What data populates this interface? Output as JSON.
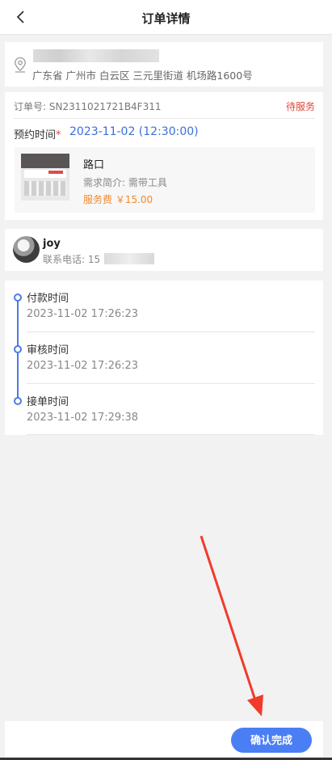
{
  "header": {
    "title": "订单详情",
    "back_icon": "chevron-left-icon"
  },
  "address": {
    "icon": "location-pin-icon",
    "text": "广东省 广州市 白云区 三元里街道 机场路1600号"
  },
  "order": {
    "number_label": "订单号:",
    "number": "SN2311021721B4F311",
    "status": "待服务",
    "appointment_label": "预约时间",
    "required_mark": "*",
    "appointment_time": "2023-11-02 (12:30:00)",
    "product": {
      "name": "路口",
      "desc": "需求简介: 需带工具",
      "price": "服务费 ￥15.00"
    }
  },
  "user": {
    "name": "joy",
    "phone_label": "联系电话: 15"
  },
  "timeline": [
    {
      "label": "付款时间",
      "time": "2023-11-02 17:26:23"
    },
    {
      "label": "审核时间",
      "time": "2023-11-02 17:26:23"
    },
    {
      "label": "接单时间",
      "time": "2023-11-02 17:29:38"
    }
  ],
  "footer": {
    "confirm_label": "确认完成"
  },
  "colors": {
    "accent": "#4a7ef4",
    "status": "#e0473b",
    "price": "#f08a2c",
    "annotation_arrow": "#f23a2a"
  }
}
